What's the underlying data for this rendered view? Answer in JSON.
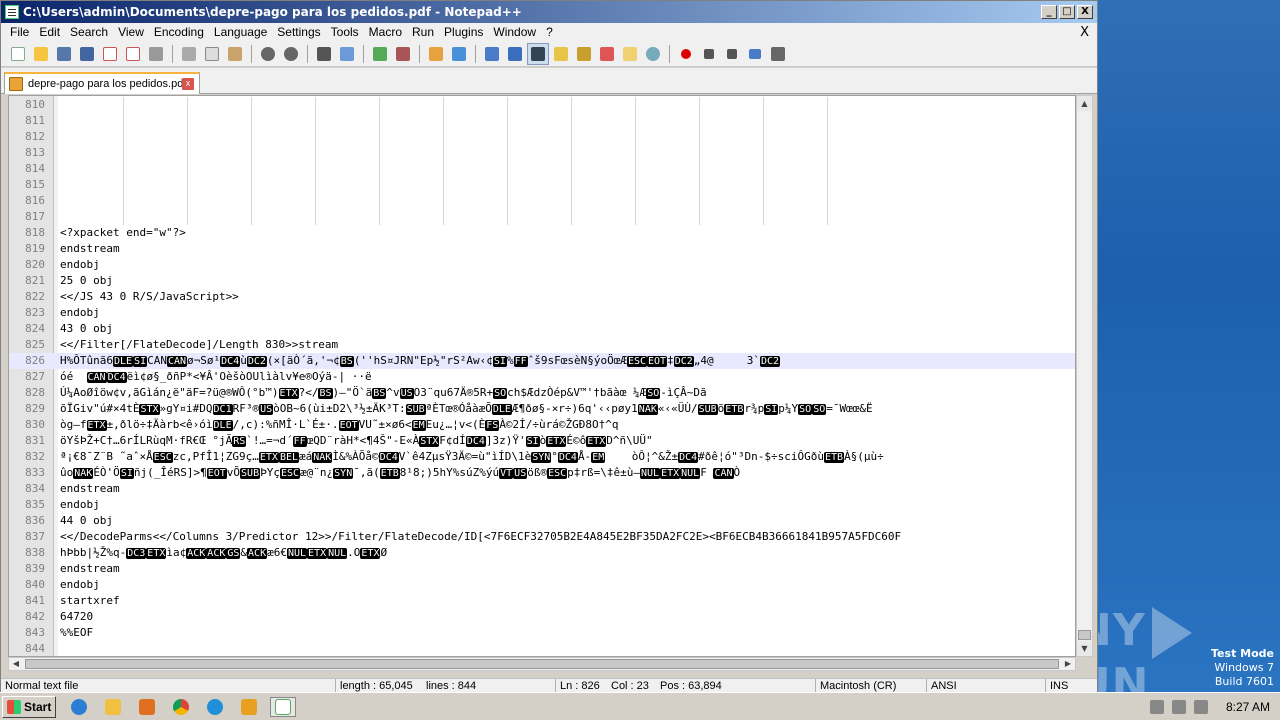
{
  "window": {
    "title": "C:\\Users\\admin\\Documents\\depre-pago para los pedidos.pdf - Notepad++",
    "controls": {
      "minimize": "_",
      "maximize": "□",
      "close": "X"
    }
  },
  "menu": [
    "File",
    "Edit",
    "Search",
    "View",
    "Encoding",
    "Language",
    "Settings",
    "Tools",
    "Macro",
    "Run",
    "Plugins",
    "Window",
    "?"
  ],
  "menu_close": "X",
  "tab": {
    "label": "depre-pago para los pedidos.pdf",
    "close": "x"
  },
  "editor": {
    "current_line": 826,
    "lines": [
      {
        "n": "810",
        "t": ""
      },
      {
        "n": "811",
        "t": ""
      },
      {
        "n": "812",
        "t": ""
      },
      {
        "n": "813",
        "t": ""
      },
      {
        "n": "814",
        "t": ""
      },
      {
        "n": "815",
        "t": ""
      },
      {
        "n": "816",
        "t": ""
      },
      {
        "n": "817",
        "t": ""
      },
      {
        "n": "818",
        "t": "<?xpacket end=\"w\"?>"
      },
      {
        "n": "819",
        "t": "endstream"
      },
      {
        "n": "820",
        "t": "endobj"
      },
      {
        "n": "821",
        "t": "25 0 obj"
      },
      {
        "n": "822",
        "t": "<</JS 43 0 R/S/JavaScript>>"
      },
      {
        "n": "823",
        "t": "endobj"
      },
      {
        "n": "824",
        "t": "43 0 obj"
      },
      {
        "n": "825",
        "t": "<</Filter[/FlateDecode]/Length 830>>stream"
      },
      {
        "n": "826",
        "t": "H%ÔTûnã6[DLE][SI]CAN[CAN]ø¬Sø¹[DC4]ù[DC2](×[äÒ´ã,'¬¢[BS](''hS¤JRN\"Ep½\"rS²Aw‹¢[SI]%[FF]ˆš9sFœsèN§ýoÖœÆ[ESC][EOT]‡[DC2]„4@     3`[DC2]"
      },
      {
        "n": "827",
        "t": "óé  [CAN][DC4]ëì¢ø§_ðñP*<¥Â'OèšòOUlìàlv¥e®Oýä-| ··ë"
      },
      {
        "n": "828",
        "t": "Ú¼AoØîöw¢v,ãGìán¿ë\"äF=?ü@®WÔ(°b™)[ETX]?</[BS])—\"Ö`ä[BS]^v[US]O3¨qu67Ä®5R+[SO]ch$ÆdzÒép&V™'†bãàœ ¼Æ[SO]-ìÇÂ~Dã"
      },
      {
        "n": "829",
        "t": "õÏGiv\"ú#×4tÈ[STX]»gY¤i#DQ[DC1]RF³®[US]òOB~6(ùi±D2\\³½±ÄK³T:[SUB]ªÈTœ®ÓåàæÕ[DLE]Æ¶ðø§-×r÷)6q'‹‹pøy1[NAK]«‹«ÜÙ/[SUB]õ[ETB]r¾p[SI]p¼Y[SO][SO]=¯Wœœ&Ë"
      },
      {
        "n": "830",
        "t": "òg—f[ETX]±,ðlö÷‡Äàrb<ê›óì[DLE]/,c):%ñMÎ·L`É±·.[EOT]VU˜±×ø6<[EM]Eu¿…¦v<(È[FS]À©2Í/÷ùrá©ŽGÐ8O†^q"
      },
      {
        "n": "831",
        "t": "öYšÞŽ+C†…6rÍLRùqM·fR€Œ °jÃ[RS]`!…=¬d´[FF]œQD¨ràH*<¶4Š\"-E«À[STX]F¢dÍ[DC4]]3z)Ÿ'[SI]ò[ETX]É©ô[ETX]D^ñ\\UÜ\""
      },
      {
        "n": "832",
        "t": "ª¡€8¯Z¨B ˜aˆ×Å[ESC]zc,PfÎ1¦ZG9ç…[ETX][BEL]æá[NAK]Ì&%ÀÕå©[DC4]V`ê4ZµsŸ3Ä©=ù\"ìÍD\\1è[SYN]°[DC4]Å-[EM]    òÔ¦^&Ž±[DC4]#ðê¦ó\"³Dn-$÷sciÔGðù[ETB]À§(µù÷"
      },
      {
        "n": "833",
        "t": "ûo[NAK]ÉÒ'Ö[SI]ñj(_ÎéRS]>¶[EOT]vÕ[SUB]ÞYç[ESC]æ@¨n¿[SYN]¯,ã([ETB]8¹8;)5hY%súZ%ýú[VT][US]öß®[ESC]p‡rß=\\‡ê±ù—[NUL][ETX][NUL]F [CAN]Ò"
      },
      {
        "n": "834",
        "t": "endstream"
      },
      {
        "n": "835",
        "t": "endobj"
      },
      {
        "n": "836",
        "t": "44 0 obj"
      },
      {
        "n": "837",
        "t": "<</DecodeParms<</Columns 3/Predictor 12>>/Filter/FlateDecode/ID[<7F6ECF32705B2E4A845E2BF35DA2FC2E><BF6ECB4B36661841B957A5FDC60F"
      },
      {
        "n": "838",
        "t": "hÞbb|½Ž%q-[DC3][ETX]ìa¢[ACK][ACK][GS]&[ACK]æ6€[NUL][ETX][NUL].O[ETX]Ø"
      },
      {
        "n": "839",
        "t": "endstream"
      },
      {
        "n": "840",
        "t": "endobj"
      },
      {
        "n": "841",
        "t": "startxref"
      },
      {
        "n": "842",
        "t": "64720"
      },
      {
        "n": "843",
        "t": "%%EOF"
      },
      {
        "n": "844",
        "t": ""
      }
    ]
  },
  "status": {
    "filetype": "Normal text file",
    "length": "length : 65,045",
    "lines": "lines : 844",
    "ln": "Ln : 826",
    "col": "Col : 23",
    "pos": "Pos : 63,894",
    "eol": "Macintosh (CR)",
    "encoding": "ANSI",
    "ins": "INS"
  },
  "taskbar": {
    "start": "Start",
    "clock": "8:27 AM"
  },
  "desktop": {
    "watermark": "ANY RUN",
    "testmode": [
      "Test Mode",
      "Windows 7",
      "Build 7601"
    ]
  }
}
